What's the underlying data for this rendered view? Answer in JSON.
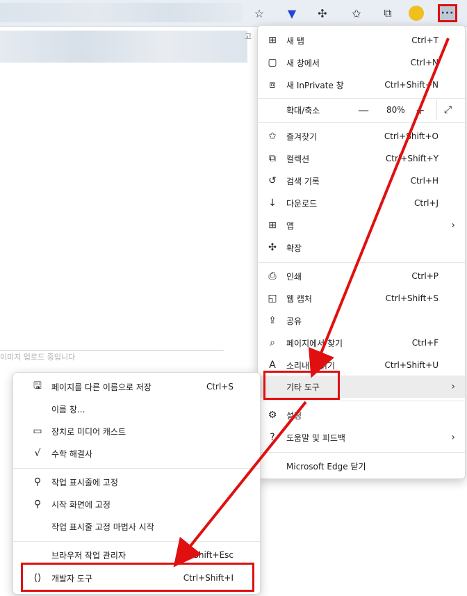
{
  "toolbar": {
    "icons": [
      "favorite-add-icon",
      "download-arrow-icon",
      "extensions-icon",
      "favorites-icon",
      "collections-icon",
      "profile-icon"
    ],
    "more_label": "···"
  },
  "page": {
    "caption": "이미지 업로드 중입니다",
    "fragment_top": "고"
  },
  "main_menu": {
    "items": [
      {
        "label": "새 탭",
        "shortcut": "Ctrl+T",
        "icon": "new-tab-icon"
      },
      {
        "label": "새 창에서",
        "shortcut": "Ctrl+N",
        "icon": "new-window-icon"
      },
      {
        "label": "새 InPrivate 창",
        "shortcut": "Ctrl+Shift+N",
        "icon": "inprivate-icon"
      },
      {
        "label": "확대/축소",
        "zoom": "80%",
        "minus": "—",
        "plus": "+",
        "icon": "zoom"
      },
      {
        "label": "즐겨찾기",
        "shortcut": "Ctrl+Shift+O",
        "icon": "favorites-icon"
      },
      {
        "label": "컬렉션",
        "shortcut": "Ctrl+Shift+Y",
        "icon": "collections-icon"
      },
      {
        "label": "검색 기록",
        "shortcut": "Ctrl+H",
        "icon": "history-icon"
      },
      {
        "label": "다운로드",
        "shortcut": "Ctrl+J",
        "icon": "download-icon"
      },
      {
        "label": "앱",
        "shortcut": "",
        "icon": "apps-icon"
      },
      {
        "label": "확장",
        "shortcut": "",
        "icon": "extensions-icon"
      },
      {
        "label": "인쇄",
        "shortcut": "Ctrl+P",
        "icon": "print-icon"
      },
      {
        "label": "웹 캡처",
        "shortcut": "Ctrl+Shift+S",
        "icon": "web-capture-icon"
      },
      {
        "label": "공유",
        "shortcut": "",
        "icon": "share-icon"
      },
      {
        "label": "페이지에서 찾기",
        "shortcut": "Ctrl+F",
        "icon": "find-icon"
      },
      {
        "label": "소리내어 읽기",
        "shortcut": "Ctrl+Shift+U",
        "icon": "read-aloud-icon"
      },
      {
        "label": "기타 도구",
        "shortcut": "",
        "icon": ""
      },
      {
        "label": "설정",
        "shortcut": "",
        "icon": "settings-icon"
      },
      {
        "label": "도움말 및 피드백",
        "shortcut": "",
        "icon": "help-icon"
      },
      {
        "label": "Microsoft Edge 닫기",
        "shortcut": "",
        "icon": ""
      }
    ]
  },
  "sub_menu": {
    "items": [
      {
        "label": "페이지를 다른 이름으로 저장",
        "shortcut": "Ctrl+S",
        "icon": "save-page-icon"
      },
      {
        "label": "이름 창...",
        "shortcut": "",
        "icon": ""
      },
      {
        "label": "장치로 미디어 캐스트",
        "shortcut": "",
        "icon": "cast-icon"
      },
      {
        "label": "수학 해결사",
        "shortcut": "",
        "icon": "math-solver-icon"
      },
      {
        "label": "작업 표시줄에 고정",
        "shortcut": "",
        "icon": "pin-icon"
      },
      {
        "label": "시작 화면에 고정",
        "shortcut": "",
        "icon": "pin-icon"
      },
      {
        "label": "작업 표시줄 고정 마법사 시작",
        "shortcut": "",
        "icon": ""
      },
      {
        "label": "브라우저 작업 관리자",
        "shortcut": "Shift+Esc",
        "icon": ""
      },
      {
        "label": "개발자 도구",
        "shortcut": "Ctrl+Shift+I",
        "icon": "dev-tools-icon"
      }
    ]
  },
  "colors": {
    "annotation_red": "#e01010",
    "menu_highlight": "#ececec",
    "toolbar_bg": "#e9eef4"
  }
}
